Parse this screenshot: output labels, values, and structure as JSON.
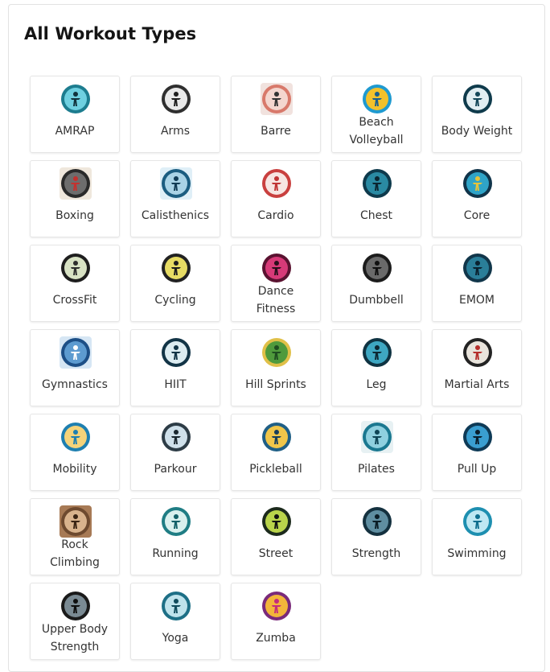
{
  "title": "All Workout Types",
  "workouts": [
    {
      "label": "AMRAP",
      "lines": [
        "AMRAP"
      ],
      "icon": "amrap-icon",
      "bg": "#ffffff",
      "ring": "#1d7d8f",
      "fill": "#6fd0e0",
      "glyph": "#12333d"
    },
    {
      "label": "Arms",
      "lines": [
        "Arms"
      ],
      "icon": "arms-icon",
      "bg": "#ffffff",
      "ring": "#2f2f2f",
      "fill": "#e9e9e9",
      "glyph": "#1f1f1f"
    },
    {
      "label": "Barre",
      "lines": [
        "Barre"
      ],
      "icon": "barre-icon",
      "bg": "#f1e2de",
      "ring": "#d8796b",
      "fill": "#f4d6cf",
      "glyph": "#333333"
    },
    {
      "label": "Beach Volleyball",
      "lines": [
        "Beach",
        "Volleyball"
      ],
      "icon": "beach-volleyball-icon",
      "bg": "#ffffff",
      "ring": "#1f9ad0",
      "fill": "#f3c12b",
      "glyph": "#1a5f8e"
    },
    {
      "label": "Body Weight",
      "lines": [
        "Body Weight"
      ],
      "icon": "body-weight-icon",
      "bg": "#ffffff",
      "ring": "#0f3b4c",
      "fill": "#e2eef2",
      "glyph": "#16485a"
    },
    {
      "label": "Boxing",
      "lines": [
        "Boxing"
      ],
      "icon": "boxing-icon",
      "bg": "#efe7dc",
      "ring": "#2a2a2a",
      "fill": "#6d6d6d",
      "glyph": "#c3322f"
    },
    {
      "label": "Calisthenics",
      "lines": [
        "Calisthenics"
      ],
      "icon": "calisthenics-icon",
      "bg": "#dfeff7",
      "ring": "#1b5d80",
      "fill": "#a9d3e6",
      "glyph": "#123c55"
    },
    {
      "label": "Cardio",
      "lines": [
        "Cardio"
      ],
      "icon": "cardio-icon",
      "bg": "#ffffff",
      "ring": "#c9403f",
      "fill": "#f7e5e2",
      "glyph": "#c03535"
    },
    {
      "label": "Chest",
      "lines": [
        "Chest"
      ],
      "icon": "chest-icon",
      "bg": "#ffffff",
      "ring": "#0e3a4c",
      "fill": "#2a8aa3",
      "glyph": "#0b2531"
    },
    {
      "label": "Core",
      "lines": [
        "Core"
      ],
      "icon": "core-icon",
      "bg": "#ffffff",
      "ring": "#10344a",
      "fill": "#2fa4c8",
      "glyph": "#e5c33b"
    },
    {
      "label": "CrossFit",
      "lines": [
        "CrossFit"
      ],
      "icon": "crossfit-icon",
      "bg": "#ffffff",
      "ring": "#1e1e1e",
      "fill": "#d8e2c4",
      "glyph": "#2e2e2e"
    },
    {
      "label": "Cycling",
      "lines": [
        "Cycling"
      ],
      "icon": "cycling-icon",
      "bg": "#ffffff",
      "ring": "#222222",
      "fill": "#e7dc64",
      "glyph": "#1d1d1d"
    },
    {
      "label": "Dance Fitness",
      "lines": [
        "Dance",
        "Fitness"
      ],
      "icon": "dance-fitness-icon",
      "bg": "#ffffff",
      "ring": "#5a1230",
      "fill": "#d73a78",
      "glyph": "#2a0f1c"
    },
    {
      "label": "Dumbbell",
      "lines": [
        "Dumbbell"
      ],
      "icon": "dumbbell-icon",
      "bg": "#ffffff",
      "ring": "#1c1c1c",
      "fill": "#6a6a6a",
      "glyph": "#111111"
    },
    {
      "label": "EMOM",
      "lines": [
        "EMOM"
      ],
      "icon": "emom-icon",
      "bg": "#ffffff",
      "ring": "#11364a",
      "fill": "#2a7e99",
      "glyph": "#0a2230"
    },
    {
      "label": "Gymnastics",
      "lines": [
        "Gymnastics"
      ],
      "icon": "gymnastics-icon",
      "bg": "#d6e6f4",
      "ring": "#1d4f86",
      "fill": "#5d9bd0",
      "glyph": "#ffffff"
    },
    {
      "label": "HIIT",
      "lines": [
        "HIIT"
      ],
      "icon": "hiit-icon",
      "bg": "#ffffff",
      "ring": "#123446",
      "fill": "#dcecf1",
      "glyph": "#123446"
    },
    {
      "label": "Hill Sprints",
      "lines": [
        "Hill Sprints"
      ],
      "icon": "hill-sprints-icon",
      "bg": "#ffffff",
      "ring": "#e0c048",
      "fill": "#4f9a3c",
      "glyph": "#1f4d21"
    },
    {
      "label": "Leg",
      "lines": [
        "Leg"
      ],
      "icon": "leg-icon",
      "bg": "#ffffff",
      "ring": "#0f3342",
      "fill": "#3ea7c2",
      "glyph": "#0d2733"
    },
    {
      "label": "Martial Arts",
      "lines": [
        "Martial Arts"
      ],
      "icon": "martial-arts-icon",
      "bg": "#ffffff",
      "ring": "#232323",
      "fill": "#e9e4dc",
      "glyph": "#b52f2c"
    },
    {
      "label": "Mobility",
      "lines": [
        "Mobility"
      ],
      "icon": "mobility-icon",
      "bg": "#ffffff",
      "ring": "#1e7fb0",
      "fill": "#f4d37a",
      "glyph": "#1e7fb0"
    },
    {
      "label": "Parkour",
      "lines": [
        "Parkour"
      ],
      "icon": "parkour-icon",
      "bg": "#ffffff",
      "ring": "#2d3c46",
      "fill": "#cfe0ea",
      "glyph": "#1b2830"
    },
    {
      "label": "Pickleball",
      "lines": [
        "Pickleball"
      ],
      "icon": "pickleball-icon",
      "bg": "#ffffff",
      "ring": "#1f5f86",
      "fill": "#f0c64a",
      "glyph": "#173f5c"
    },
    {
      "label": "Pilates",
      "lines": [
        "Pilates"
      ],
      "icon": "pilates-icon",
      "bg": "#e7f1f3",
      "ring": "#1a7890",
      "fill": "#8fd0df",
      "glyph": "#0f4657"
    },
    {
      "label": "Pull Up",
      "lines": [
        "Pull Up"
      ],
      "icon": "pull-up-icon",
      "bg": "#ffffff",
      "ring": "#0e3a56",
      "fill": "#3a9ed0",
      "glyph": "#0a1e2c"
    },
    {
      "label": "Rock Climbing",
      "lines": [
        "Rock",
        "Climbing"
      ],
      "icon": "rock-climbing-icon",
      "bg": "#a77a55",
      "ring": "#6e4a2f",
      "fill": "#d9b38d",
      "glyph": "#3a2414"
    },
    {
      "label": "Running",
      "lines": [
        "Running"
      ],
      "icon": "running-icon",
      "bg": "#ffffff",
      "ring": "#1f7d84",
      "fill": "#d9f0ee",
      "glyph": "#126068"
    },
    {
      "label": "Street",
      "lines": [
        "Street"
      ],
      "icon": "street-icon",
      "bg": "#ffffff",
      "ring": "#1c2a1c",
      "fill": "#b9d44b",
      "glyph": "#111111"
    },
    {
      "label": "Strength",
      "lines": [
        "Strength"
      ],
      "icon": "strength-icon",
      "bg": "#ffffff",
      "ring": "#14313f",
      "fill": "#5f8ea1",
      "glyph": "#0b1d26"
    },
    {
      "label": "Swimming",
      "lines": [
        "Swimming"
      ],
      "icon": "swimming-icon",
      "bg": "#ffffff",
      "ring": "#1d8fb0",
      "fill": "#bfe8f3",
      "glyph": "#0f6e8e"
    },
    {
      "label": "Upper Body Strength",
      "lines": [
        "Upper Body",
        "Strength"
      ],
      "icon": "upper-body-strength-icon",
      "bg": "#ffffff",
      "ring": "#1a1a1a",
      "fill": "#7a8a93",
      "glyph": "#0f0f0f"
    },
    {
      "label": "Yoga",
      "lines": [
        "Yoga"
      ],
      "icon": "yoga-icon",
      "bg": "#ffffff",
      "ring": "#1d6f86",
      "fill": "#bfe3ec",
      "glyph": "#114c5d"
    },
    {
      "label": "Zumba",
      "lines": [
        "Zumba"
      ],
      "icon": "zumba-icon",
      "bg": "#ffffff",
      "ring": "#7a2a7a",
      "fill": "#f3b53a",
      "glyph": "#c42c7c"
    }
  ]
}
